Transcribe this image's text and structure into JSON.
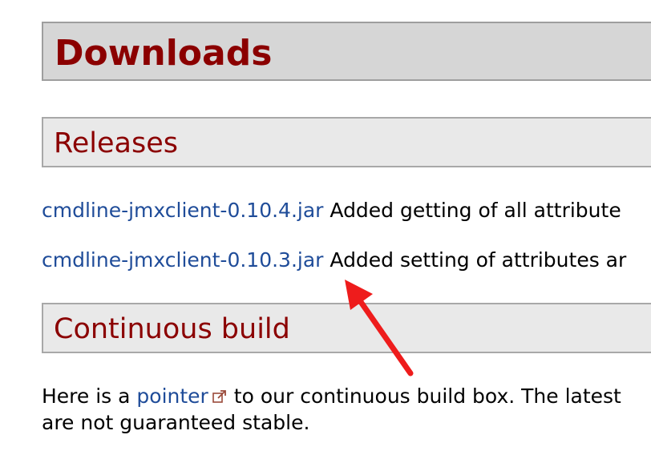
{
  "downloads": {
    "title": "Downloads"
  },
  "releases": {
    "heading": "Releases",
    "items": [
      {
        "link": "cmdline-jmxclient-0.10.4.jar",
        "description": " Added getting of all attribute"
      },
      {
        "link": "cmdline-jmxclient-0.10.3.jar",
        "description": " Added setting of attributes ar"
      }
    ]
  },
  "continuous_build": {
    "heading": "Continuous build",
    "text_before": "Here is a ",
    "link": "pointer",
    "text_after": " to our continuous build box. The latest",
    "line2": "are not guaranteed stable."
  },
  "annotation": {
    "arrow_color": "#ee1c1c"
  },
  "colors": {
    "heading": "#8b0000",
    "link": "#1f4c99"
  }
}
